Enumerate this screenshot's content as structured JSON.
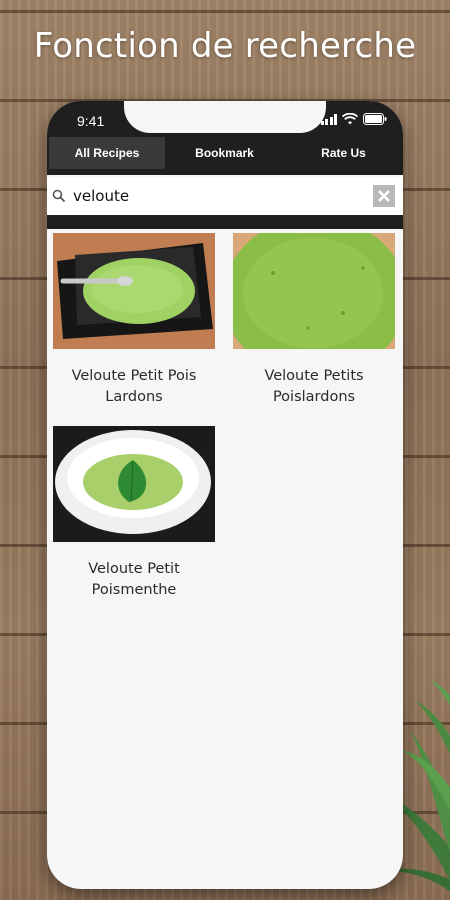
{
  "headline": "Fonction de recherche",
  "status": {
    "time": "9:41"
  },
  "tabs": [
    {
      "label": "All Recipes",
      "active": true
    },
    {
      "label": "Bookmark",
      "active": false
    },
    {
      "label": "Rate Us",
      "active": false
    }
  ],
  "search": {
    "value": "veloute"
  },
  "recipes": [
    {
      "title": "Veloute Petit Pois Lardons",
      "image": "green soup in black square bowl with spoon"
    },
    {
      "title": "Veloute Petits Poislardons",
      "image": "close-up of green soup surface"
    },
    {
      "title": "Veloute Petit Poismenthe",
      "image": "green soup in white bowl with mint leaf"
    }
  ],
  "colors": {
    "tabbar": "#1f1f1f",
    "active_tab": "#3a3a3a",
    "screen_bg": "#f6f6f6",
    "soup": "#8fc55a"
  }
}
